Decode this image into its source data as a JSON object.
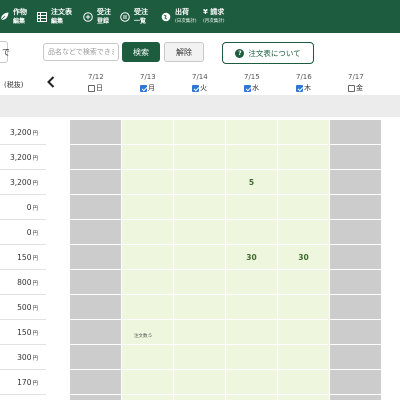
{
  "nav": {
    "items": [
      {
        "label1": "作物",
        "label2": "編集",
        "icon": "leaf-icon"
      },
      {
        "label1": "注文表",
        "label2": "編集",
        "icon": "grid-icon"
      },
      {
        "label1": "受注",
        "label2": "登録",
        "icon": "plus-circle-icon"
      },
      {
        "label1": "受注",
        "label2": "一覧",
        "icon": "list-icon"
      },
      {
        "label1": "出荷",
        "label2": "(日次集計)",
        "icon": "globe-icon"
      },
      {
        "label1": "¥ 請求",
        "label2": "(月次集計)",
        "icon": "yen-icon"
      }
    ]
  },
  "toolbar": {
    "left_stub": "で",
    "search_placeholder": "品名などで検索できます",
    "search_label": "検索",
    "clear_label": "解除",
    "about_label": "注文表について",
    "about_icon": "question-icon"
  },
  "header": {
    "price_label": "(税抜)",
    "prev_icon": "chevron-left-icon",
    "dates": [
      {
        "date": "7/12",
        "dow": "日",
        "checked": false
      },
      {
        "date": "7/13",
        "dow": "月",
        "checked": true
      },
      {
        "date": "7/14",
        "dow": "火",
        "checked": true
      },
      {
        "date": "7/15",
        "dow": "水",
        "checked": true
      },
      {
        "date": "7/16",
        "dow": "木",
        "checked": true
      },
      {
        "date": "7/17",
        "dow": "金",
        "checked": false
      }
    ]
  },
  "rows": [
    {
      "price": "3,200",
      "cells": [
        "",
        "",
        "",
        "",
        "",
        ""
      ]
    },
    {
      "price": "3,200",
      "cells": [
        "",
        "",
        "",
        "",
        "",
        ""
      ]
    },
    {
      "price": "3,200",
      "cells": [
        "",
        "",
        "",
        "5",
        "",
        ""
      ]
    },
    {
      "price": "0",
      "cells": [
        "",
        "",
        "",
        "",
        "",
        ""
      ]
    },
    {
      "price": "0",
      "cells": [
        "",
        "",
        "",
        "",
        "",
        ""
      ]
    },
    {
      "price": "150",
      "cells": [
        "",
        "",
        "",
        "30",
        "30",
        ""
      ]
    },
    {
      "price": "800",
      "cells": [
        "",
        "",
        "",
        "",
        "",
        ""
      ]
    },
    {
      "price": "500",
      "cells": [
        "",
        "",
        "",
        "",
        "",
        ""
      ]
    },
    {
      "price": "150",
      "cells": [
        "",
        "",
        "",
        "",
        "",
        ""
      ],
      "note_col": 1,
      "note": "注文数:5"
    },
    {
      "price": "300",
      "cells": [
        "",
        "",
        "",
        "",
        "",
        ""
      ]
    },
    {
      "price": "170",
      "cells": [
        "",
        "",
        "",
        "",
        "",
        ""
      ]
    },
    {
      "price": "",
      "cells": [
        "",
        "",
        "",
        "",
        "",
        ""
      ]
    }
  ],
  "yen_unit": "円",
  "colors": {
    "brand": "#1d5c3f",
    "cell_open": "#eef6dd",
    "cell_closed": "#cccccc",
    "checkbox": "#2b78d8"
  }
}
